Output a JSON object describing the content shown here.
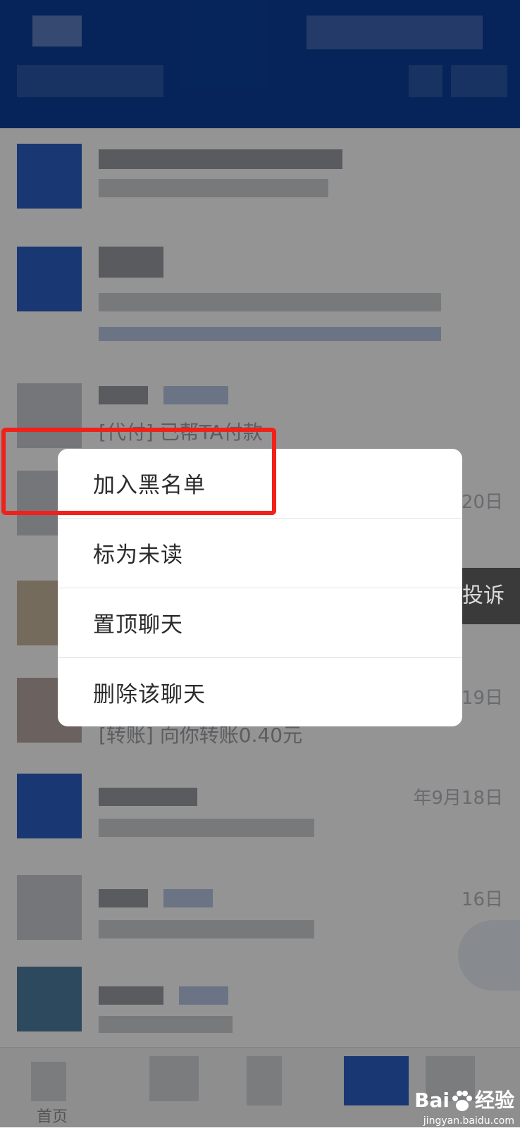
{
  "chat_list": {
    "rows": [
      {
        "preview": "",
        "time": ""
      },
      {
        "preview": "",
        "time": ""
      },
      {
        "preview": "[代付] 已帮TA付款",
        "time": ""
      },
      {
        "preview": "",
        "time": "20日"
      },
      {
        "preview": "",
        "time": ""
      },
      {
        "preview": "[转账] 向你转账0.40元",
        "time": "19日"
      },
      {
        "preview": "",
        "time": "年9月18日"
      },
      {
        "preview": "",
        "time": "16日"
      },
      {
        "preview": "",
        "time": ""
      }
    ],
    "side_action_label": "投诉"
  },
  "context_menu": {
    "items": [
      {
        "label": "加入黑名单"
      },
      {
        "label": "标为未读"
      },
      {
        "label": "置顶聊天"
      },
      {
        "label": "删除该聊天"
      }
    ]
  },
  "bottom_nav": {
    "first_tab_label": "首页"
  },
  "watermark": {
    "brand": "Bai",
    "brand_suffix": "经验",
    "url": "jingyan.baidu.com"
  },
  "colors": {
    "header": "#0b3f9c",
    "highlight": "#f2201a"
  }
}
